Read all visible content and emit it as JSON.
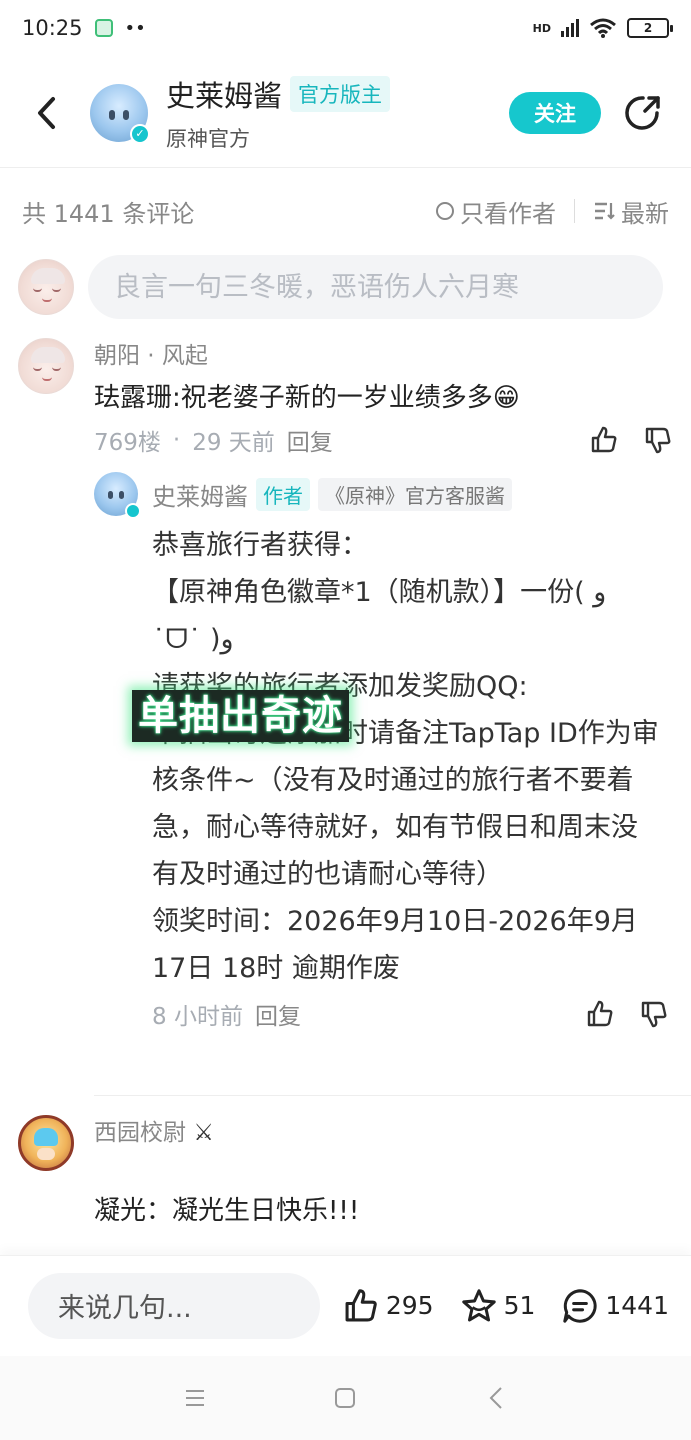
{
  "status_bar": {
    "time": "10:25",
    "more": "••",
    "battery": "2",
    "network": "HD"
  },
  "header": {
    "name": "史莱姆酱",
    "tag": "官方版主",
    "subtitle": "原神官方",
    "follow_label": "关注"
  },
  "sort_bar": {
    "count_text": "共 1441 条评论",
    "author_only": "只看作者",
    "latest": "最新"
  },
  "comment_input": {
    "placeholder": "良言一句三冬暖，恶语伤人六月寒"
  },
  "comments": [
    {
      "name": "朝阳 · 风起",
      "text": "珐露珊:祝老婆子新的一岁业绩多多😁",
      "floor": "769楼",
      "sep": "·",
      "time": "29 天前",
      "reply_label": "回复",
      "sub_reply": {
        "name": "史莱姆酱",
        "tag_author": "作者",
        "tag_role": "《原神》官方客服酱",
        "text": "恭喜旅行者获得：\n【原神角色徽章*1（随机款）】一份( و ˙ᗜ˙ )و\n请获奖的旅行者添加发奖励QQ:\n单抽出奇迹添加时请备注TapTap ID作为审核条件~（没有及时通过的旅行者不要着急，耐心等待就好，如有节假日和周末没有及时通过的也请耐心等待）\n领奖时间：2026年9月10日-2026年9月17日 18时 逾期作废",
        "time": "8 小时前",
        "reply_label": "回复"
      }
    },
    {
      "name": "西园校尉",
      "text": "凝光：凝光生日快乐!!!"
    }
  ],
  "overlay_text": "单抽出奇迹",
  "bottom_bar": {
    "say_placeholder": "来说几句...",
    "likes": "295",
    "stars": "51",
    "comments": "1441"
  },
  "colors": {
    "accent": "#16c7cd",
    "tag_bg": "#e6f8f8",
    "muted": "#888888"
  }
}
